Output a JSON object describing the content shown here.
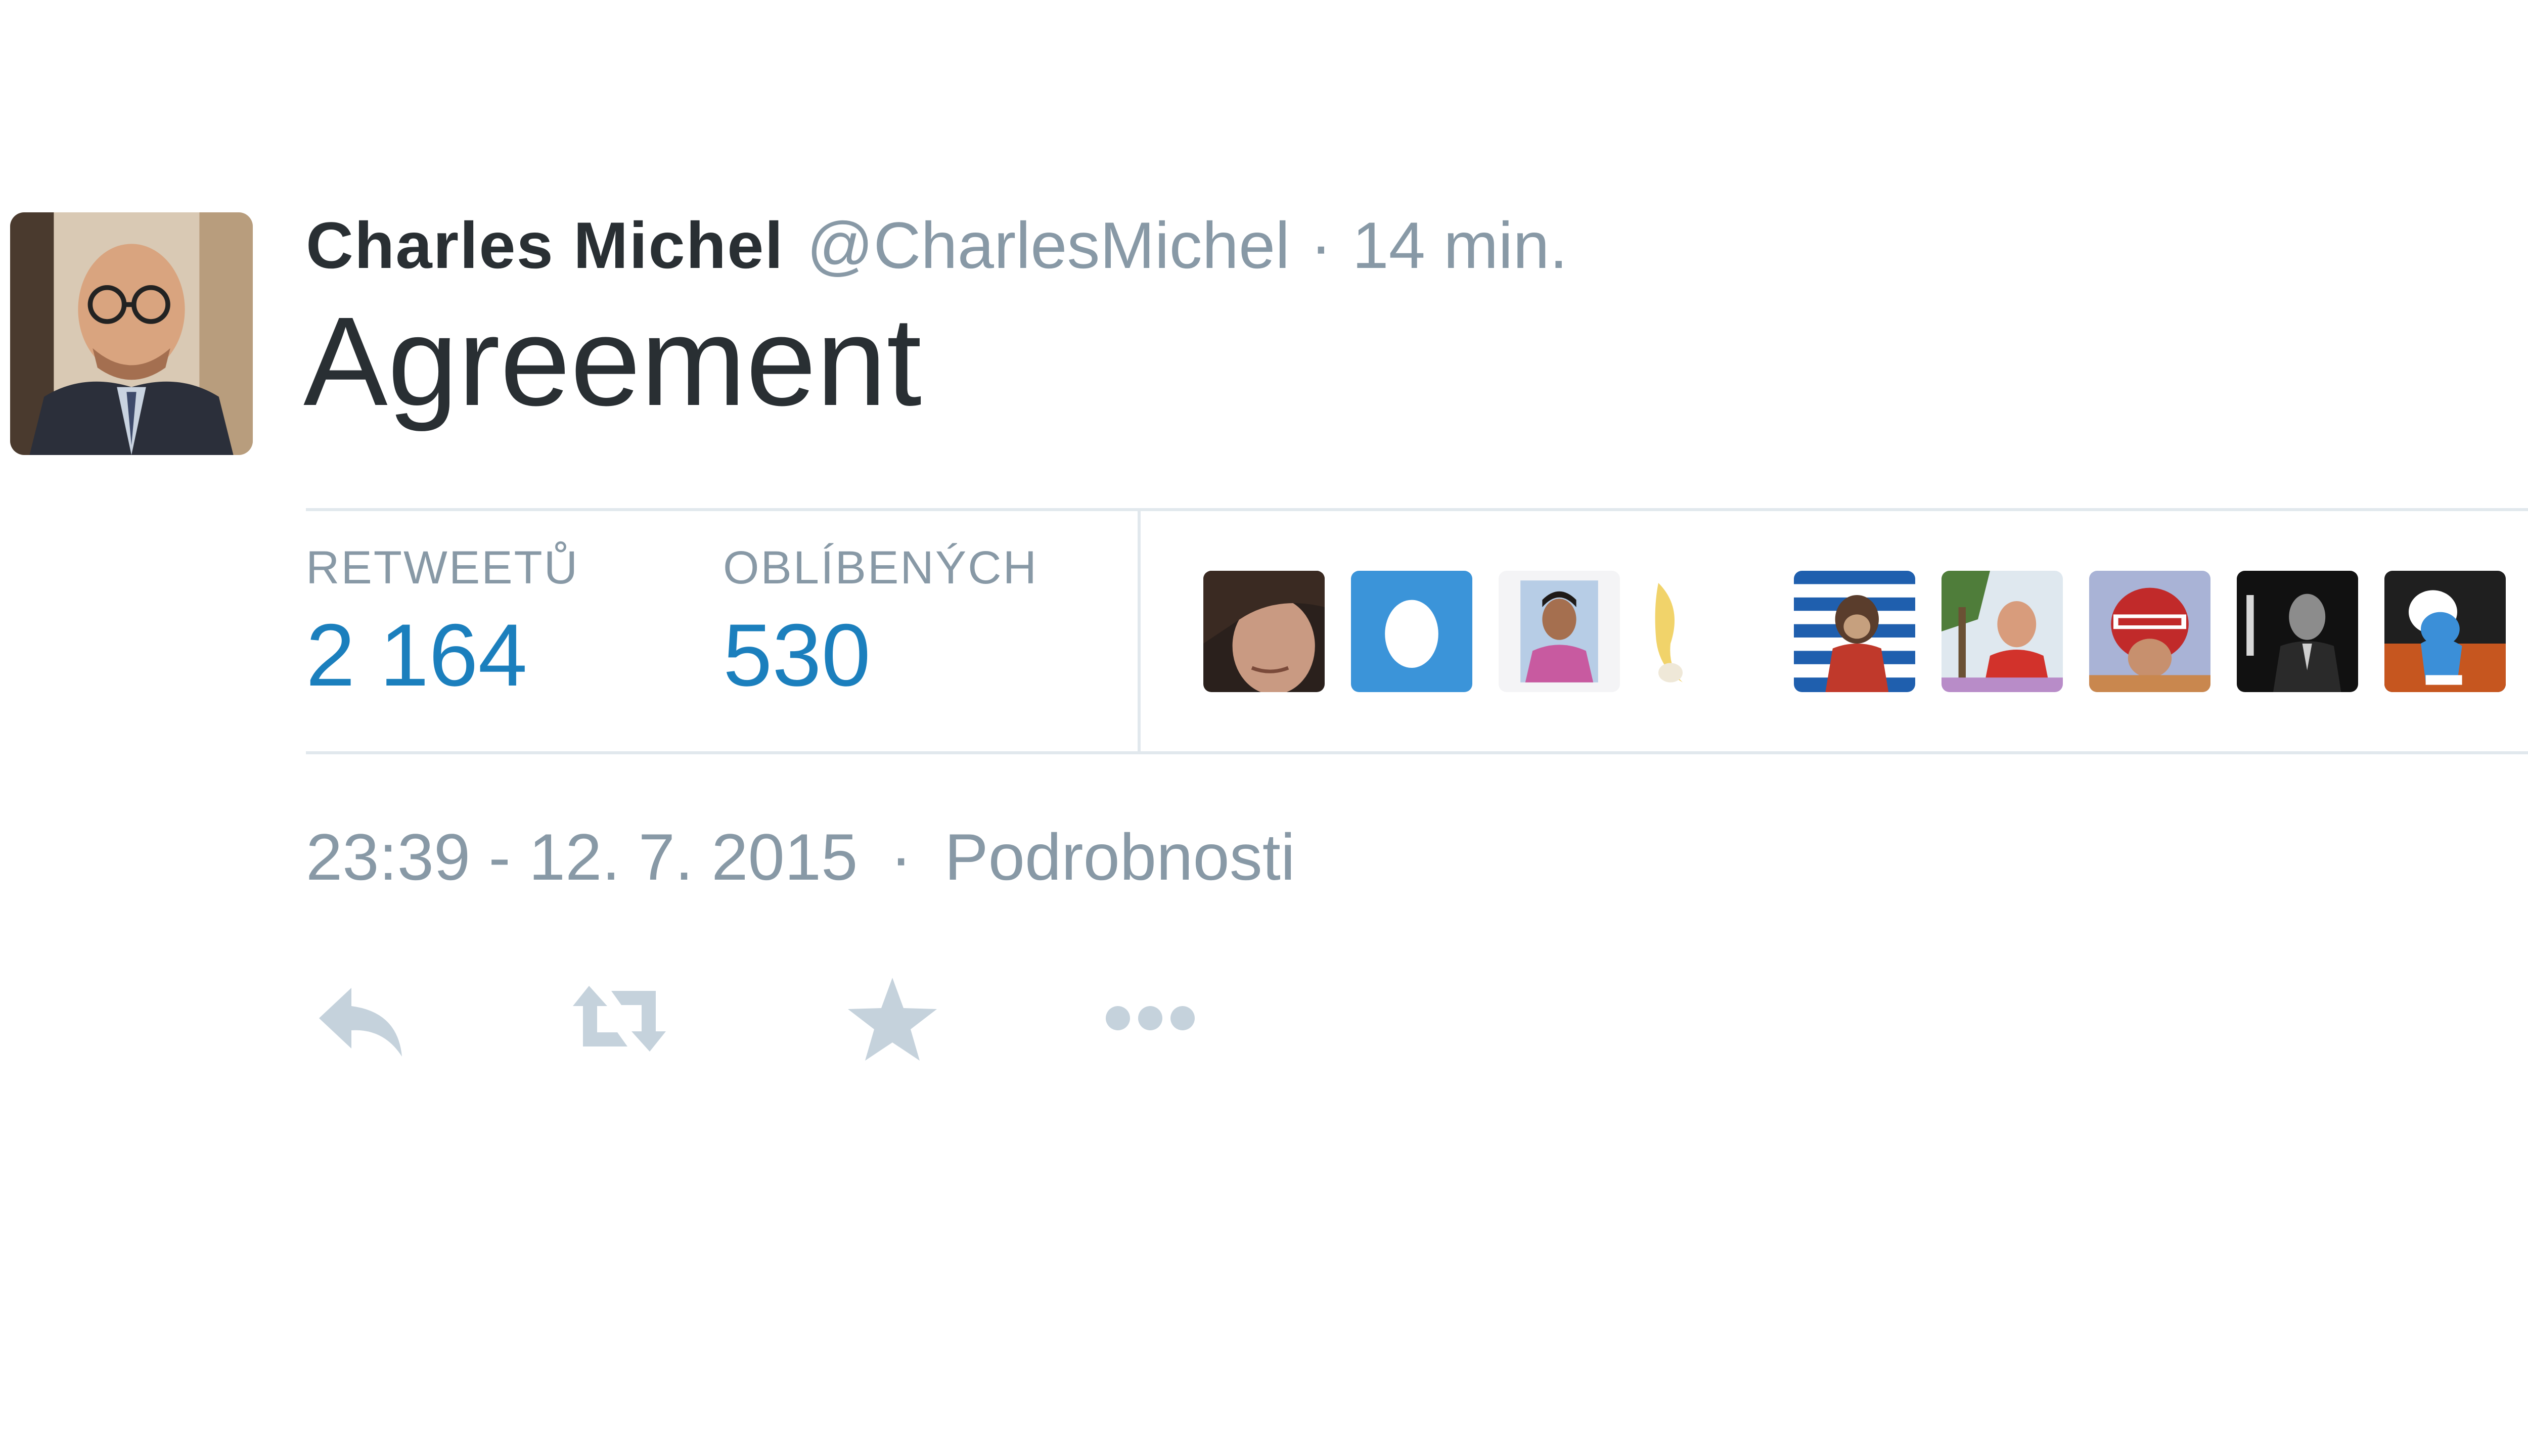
{
  "tweet": {
    "author": {
      "fullname": "Charles Michel",
      "username": "@CharlesMichel",
      "avatar_icon": "profile-photo"
    },
    "separator": "·",
    "relative_time": "14 min.",
    "text": "Agreement",
    "stats": {
      "retweets_label": "RETWEETŮ",
      "retweets_value": "2 164",
      "favorites_label": "OBLÍBENÝCH",
      "favorites_value": "530"
    },
    "favorited_by_avatars": [
      "woman-avatar",
      "default-egg-avatar",
      "man-passport-avatar",
      "banana-avatar",
      "greek-flag-monkey-avatar",
      "man-palm-tree-avatar",
      "red-helmet-avatar",
      "black-white-portrait-avatar",
      "smurf-avatar"
    ],
    "timestamp": "23:39 - 12. 7. 2015",
    "details_link": "Podrobnosti",
    "actions": {
      "reply_icon": "reply-icon",
      "retweet_icon": "retweet-icon",
      "favorite_icon": "star-icon",
      "more_icon": "more-icon"
    }
  },
  "colors": {
    "text": "#292f33",
    "muted": "#8899a6",
    "stat_value": "#1b7fbd",
    "border": "#e1e8ed",
    "action_icon": "#c5d2dc"
  }
}
